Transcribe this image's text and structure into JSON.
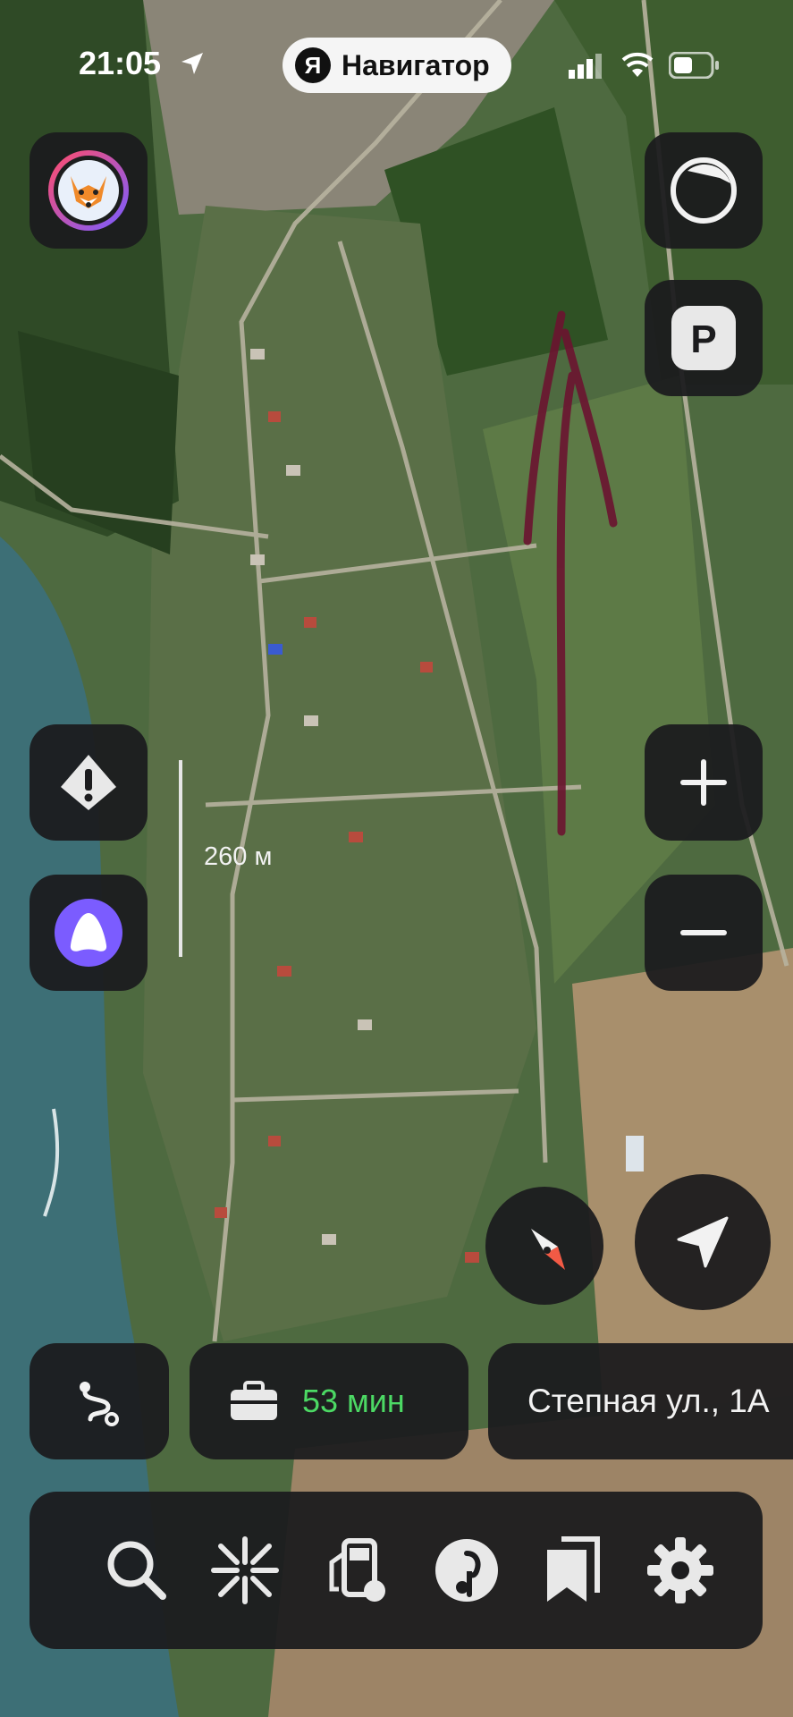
{
  "status_bar": {
    "time": "21:05",
    "app_name": "Навигатор",
    "logo_letter": "Я"
  },
  "map": {
    "scale_label": "260 м"
  },
  "trip": {
    "eta": "53 мин",
    "destination": "Степная ул., 1А"
  },
  "bottom_toolbar": {
    "items": [
      "search-icon",
      "burst-icon",
      "fuel-station-icon",
      "music-icon",
      "bookmarks-icon",
      "settings-icon"
    ]
  },
  "side_buttons": {
    "left": [
      "profile-avatar",
      "road-alert-icon",
      "alice-assistant-icon"
    ],
    "right": [
      "layers-icon",
      "parking-icon",
      "zoom-in-icon",
      "zoom-out-icon"
    ]
  },
  "colors": {
    "eta": "#4cd964",
    "route_track": "#6b1430",
    "button_bg": "#1c1c1e",
    "alice": "#7b5cff"
  }
}
